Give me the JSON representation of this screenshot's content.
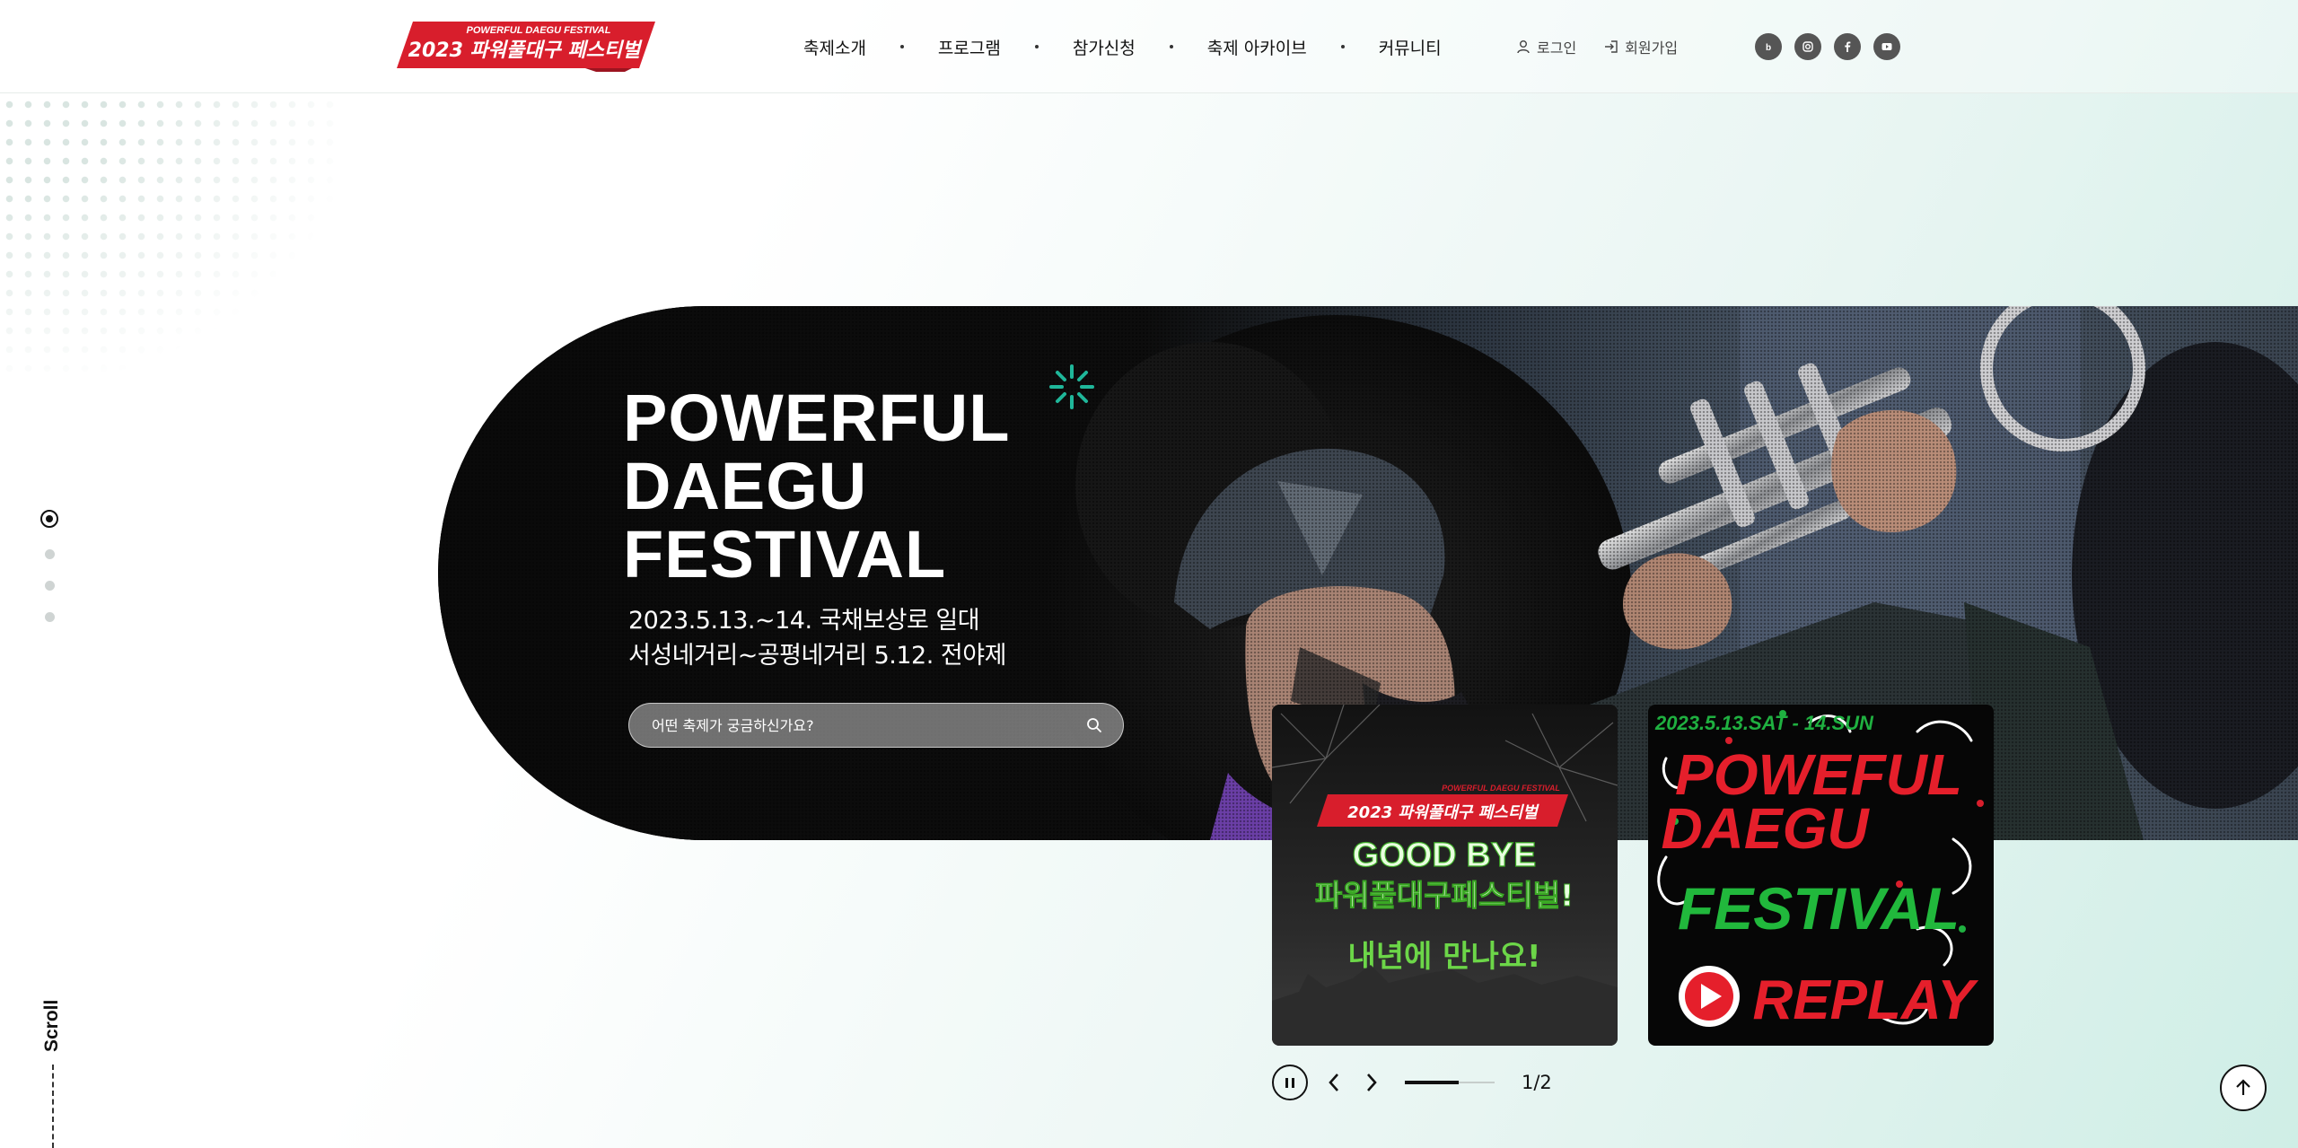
{
  "header": {
    "logo": {
      "top_text": "POWERFUL DAEGU FESTIVAL",
      "main_text": "2023 파워풀대구 페스티벌"
    },
    "nav": [
      {
        "label": "축제소개"
      },
      {
        "label": "프로그램"
      },
      {
        "label": "참가신청"
      },
      {
        "label": "축제 아카이브"
      },
      {
        "label": "커뮤니티"
      }
    ],
    "util": {
      "login": "로그인",
      "signup": "회원가입"
    },
    "social": [
      "blog-icon",
      "instagram-icon",
      "facebook-icon",
      "youtube-icon"
    ]
  },
  "hero": {
    "title_lines": [
      "POWERFUL",
      "DAEGU",
      "FESTIVAL"
    ],
    "date_line1": "2023.5.13.~14. 국채보상로 일대",
    "date_line2": "서성네거리~공평네거리 5.12. 전야제",
    "search_placeholder": "어떤 축제가 궁금하신가요?"
  },
  "side_pager": {
    "count": 4,
    "active": 0
  },
  "scroll_label": "Scroll",
  "cards": [
    {
      "badge_top": "POWERFUL DAEGU FESTIVAL",
      "badge_main": "2023 파워풀대구 페스티벌",
      "line1": "GOOD BYE",
      "line2": "파워풀대구페스티벌!",
      "line3": "내년에 만나요!"
    },
    {
      "date": "2023.5.13.SAT - 14.SUN",
      "line1": "POWEFUL",
      "line2": "DAEGU",
      "line3": "FESTIVAL",
      "line4": "REPLAY"
    }
  ],
  "slider": {
    "counter": "1/2",
    "progress": 0.6
  },
  "colors": {
    "brand_red": "#d81e2c",
    "accent_green": "#1fb79a",
    "card_green": "#6cd648"
  }
}
